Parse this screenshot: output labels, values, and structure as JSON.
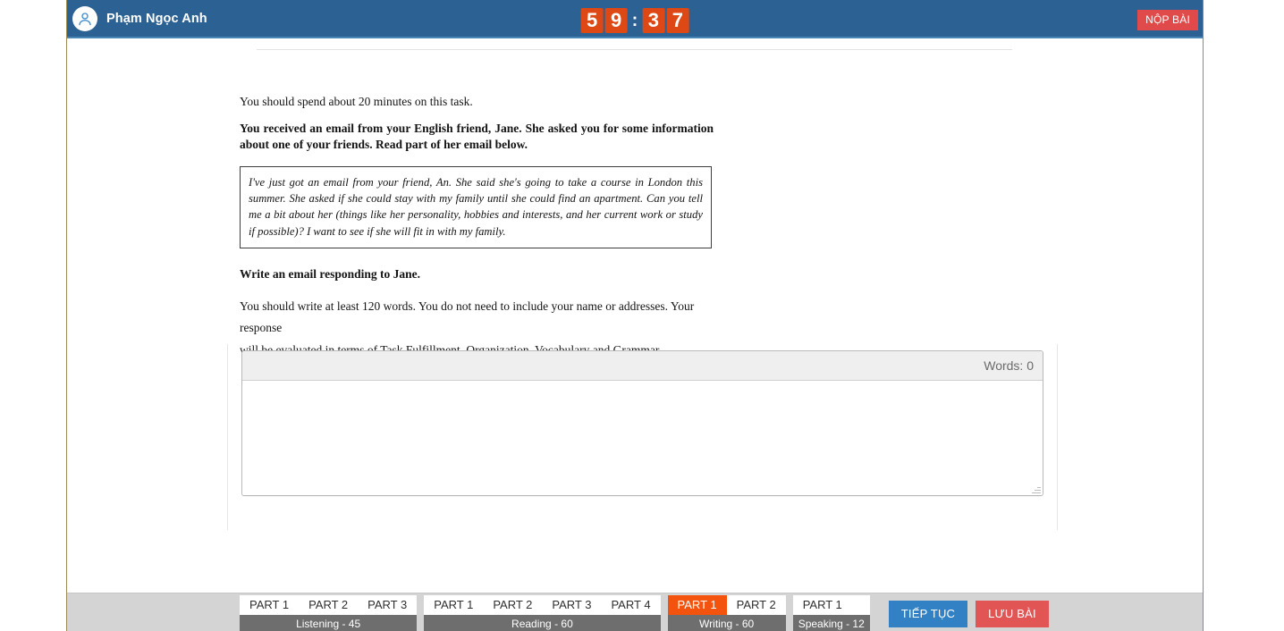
{
  "header": {
    "user_name": "Phạm Ngọc Anh",
    "avatar_icon": "user-icon",
    "submit_label": "NỘP BÀI",
    "timer": {
      "minutes_tens": "5",
      "minutes_ones": "9",
      "separator": ":",
      "seconds_tens": "3",
      "seconds_ones": "7",
      "display": "59:37",
      "digit_color": "#dd4814"
    },
    "background_color": "#2b6293"
  },
  "task": {
    "time_note": "You should spend about 20 minutes on this task.",
    "prompt_bold": "You received an email from your English friend, Jane. She asked you for some information about one of your friends. Read part of her email below.",
    "email_excerpt": "I've just got an email from your friend, An. She said she's going to take a course in London this summer. She asked if she could stay with my family until she could find an apartment. Can you tell me a bit about her (things like her personality, hobbies and interests, and her current work or study if possible)? I want to see if she will fit in with my family.",
    "instruction_bold": "Write an email responding to Jane.",
    "requirements_line1": "You should write at least 120 words. You do not need to include your name or addresses. Your response",
    "requirements_line2": "will be evaluated in terms of Task Fulfillment, Organization, Vocabulary and Grammar."
  },
  "editor": {
    "word_count_label": "Words: 0",
    "answer_value": "",
    "answer_placeholder": ""
  },
  "footer": {
    "sections": [
      {
        "name": "listening",
        "label": "Listening - 45",
        "parts": [
          {
            "label": "PART 1",
            "active": false
          },
          {
            "label": "PART 2",
            "active": false
          },
          {
            "label": "PART 3",
            "active": false
          }
        ]
      },
      {
        "name": "reading",
        "label": "Reading - 60",
        "parts": [
          {
            "label": "PART 1",
            "active": false
          },
          {
            "label": "PART 2",
            "active": false
          },
          {
            "label": "PART 3",
            "active": false
          },
          {
            "label": "PART 4",
            "active": false
          }
        ]
      },
      {
        "name": "writing",
        "label": "Writing - 60",
        "parts": [
          {
            "label": "PART 1",
            "active": true
          },
          {
            "label": "PART 2",
            "active": false
          }
        ]
      },
      {
        "name": "speaking",
        "label": "Speaking - 12",
        "parts": [
          {
            "label": "PART 1",
            "active": false
          }
        ]
      }
    ],
    "continue_label": "TIẾP TỤC",
    "save_label": "LƯU BÀI",
    "active_color": "#f4530d",
    "continue_color": "#3281c4",
    "save_color": "#e25555"
  }
}
